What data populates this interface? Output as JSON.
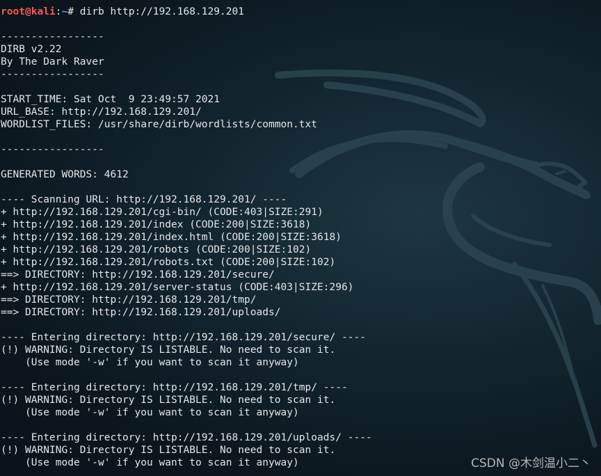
{
  "prompt": {
    "user": "root@kali",
    "separator": ":",
    "path": "~",
    "symbol": "# ",
    "command": "dirb http://192.168.129.201"
  },
  "output_lines": [
    "",
    "-----------------",
    "DIRB v2.22",
    "By The Dark Raver",
    "-----------------",
    "",
    "START_TIME: Sat Oct  9 23:49:57 2021",
    "URL_BASE: http://192.168.129.201/",
    "WORDLIST_FILES: /usr/share/dirb/wordlists/common.txt",
    "",
    "-----------------",
    "",
    "GENERATED WORDS: 4612",
    "",
    "---- Scanning URL: http://192.168.129.201/ ----",
    "+ http://192.168.129.201/cgi-bin/ (CODE:403|SIZE:291)",
    "+ http://192.168.129.201/index (CODE:200|SIZE:3618)",
    "+ http://192.168.129.201/index.html (CODE:200|SIZE:3618)",
    "+ http://192.168.129.201/robots (CODE:200|SIZE:102)",
    "+ http://192.168.129.201/robots.txt (CODE:200|SIZE:102)",
    "==> DIRECTORY: http://192.168.129.201/secure/",
    "+ http://192.168.129.201/server-status (CODE:403|SIZE:296)",
    "==> DIRECTORY: http://192.168.129.201/tmp/",
    "==> DIRECTORY: http://192.168.129.201/uploads/",
    "",
    "---- Entering directory: http://192.168.129.201/secure/ ----",
    "(!) WARNING: Directory IS LISTABLE. No need to scan it.",
    "    (Use mode '-w' if you want to scan it anyway)",
    "",
    "---- Entering directory: http://192.168.129.201/tmp/ ----",
    "(!) WARNING: Directory IS LISTABLE. No need to scan it.",
    "    (Use mode '-w' if you want to scan it anyway)",
    "",
    "---- Entering directory: http://192.168.129.201/uploads/ ----",
    "(!) WARNING: Directory IS LISTABLE. No need to scan it.",
    "    (Use mode '-w' if you want to scan it anyway)"
  ],
  "watermark": "CSDN @木剑温小二丶",
  "colors": {
    "prompt_user": "#ff5555",
    "prompt_path": "#5c9bff",
    "text": "#e6e6e6",
    "background": "#0f2028"
  }
}
